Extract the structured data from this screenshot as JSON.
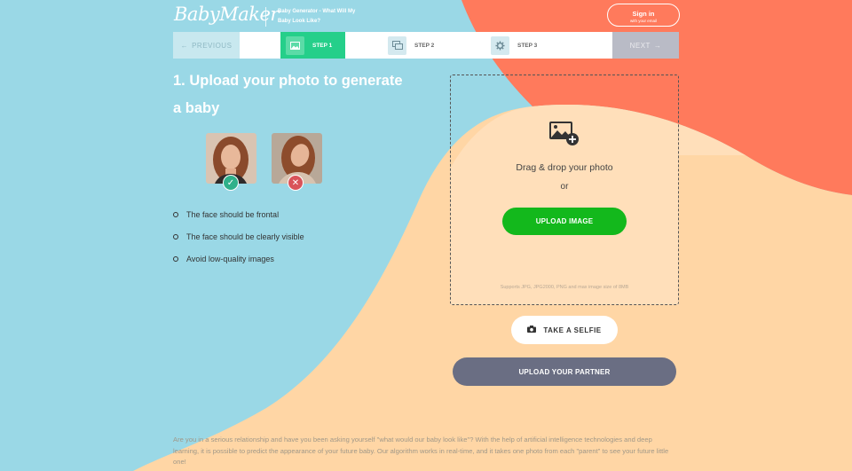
{
  "header": {
    "logo": "BabyMaker",
    "tagline": "Baby Generator - What Will My Baby Look Like?",
    "signin_label": "Sign in",
    "signin_sub": "with your email"
  },
  "stepbar": {
    "previous": "PREVIOUS",
    "steps": [
      {
        "label": "STEP 1",
        "icon": "image-icon",
        "active": true
      },
      {
        "label": "STEP 2",
        "icon": "images-icon",
        "active": false
      },
      {
        "label": "STEP 3",
        "icon": "gear-icon",
        "active": false
      }
    ],
    "next": "NEXT"
  },
  "left": {
    "title": "1. Upload your photo to generate a baby",
    "tips": [
      "The face should be frontal",
      "The face should be clearly visible",
      "Avoid low-quality images"
    ]
  },
  "upload": {
    "drag_text": "Drag & drop your photo",
    "or_text": "or",
    "button": "UPLOAD IMAGE",
    "supports": "Supports JPG, JPG2000, PNG and max image size of 8MB"
  },
  "selfie_button": "TAKE A SELFIE",
  "partner_button": "UPLOAD YOUR PARTNER",
  "description": "Are you in a serious relationship and have you been asking yourself \"what would our baby look like\"? With the help of artificial intelligence technologies and deep learning, it is possible to predict the appearance of your future baby. Our algorithm works in real-time, and it takes one photo from each \"parent\" to see your future little one!",
  "colors": {
    "background_blue": "#9ad8e6",
    "peach": "#ffdcb4",
    "coral": "#ff785a",
    "accent_green": "#13b81c",
    "step_active": "#25cf8a",
    "partner_button": "#6a6e83"
  }
}
